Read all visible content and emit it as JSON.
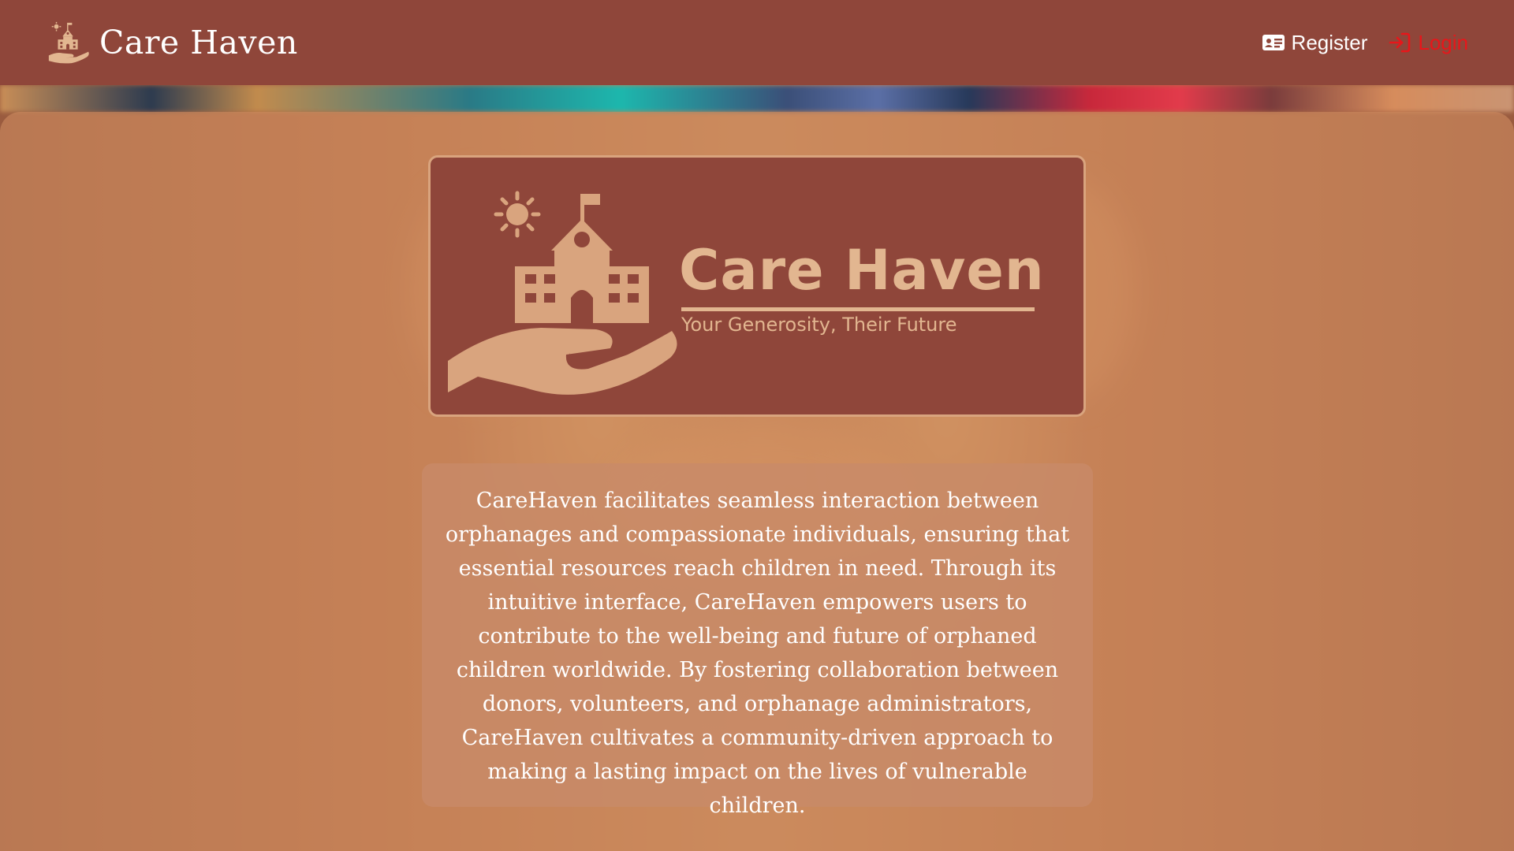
{
  "header": {
    "brand_name": "Care Haven",
    "brand_logo_icon": "orphanage-hand-icon",
    "nav": {
      "register_label": "Register",
      "register_icon": "id-card-icon",
      "login_label": "Login",
      "login_icon": "sign-in-icon"
    }
  },
  "logo_card": {
    "title": "Care Haven",
    "tagline": "Your Generosity, Their Future",
    "emblem_icon": "orphanage-hand-icon"
  },
  "description": {
    "text": "CareHaven facilitates seamless interaction between orphanages and compassionate individuals, ensuring that essential resources reach children in need. Through its intuitive interface, CareHaven empowers users to contribute to the well-being and future of orphaned children worldwide. By fostering collaboration between donors, volunteers, and orphanage administrators, CareHaven cultivates a community-driven approach to making a lasting impact on the lives of vulnerable children."
  },
  "colors": {
    "brand_background": "#8f463a",
    "logo_accent": "#e2b690",
    "login_link": "#e8161a",
    "register_link": "#ffffff"
  }
}
